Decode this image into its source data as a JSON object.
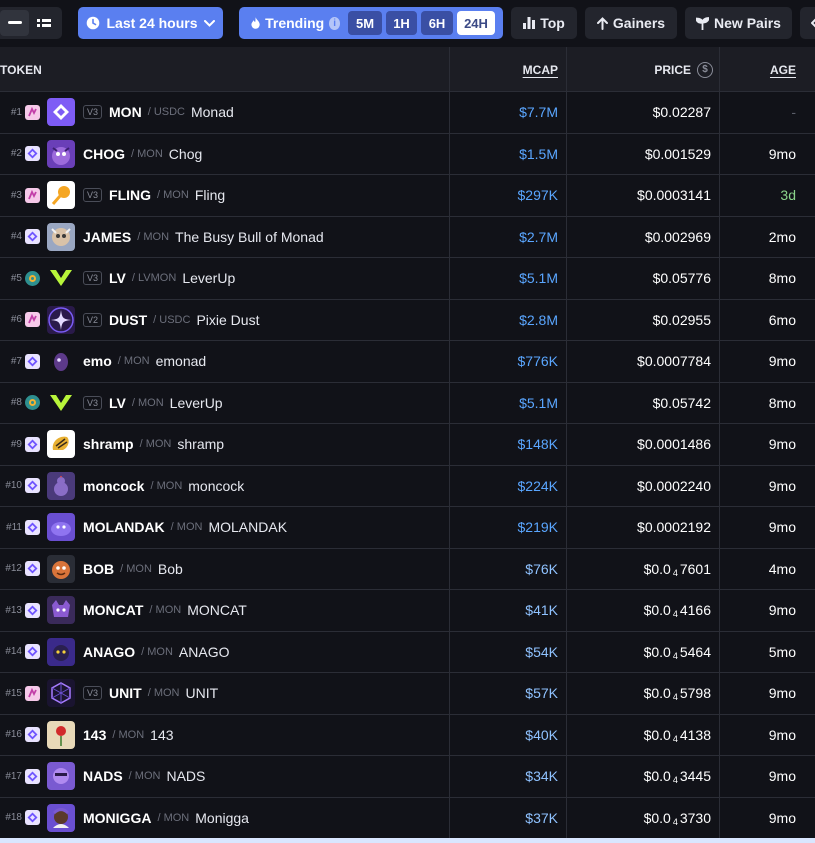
{
  "toolbar": {
    "timeframe_label": "Last 24 hours",
    "trending_label": "Trending",
    "trending_info": "i",
    "timeframes": [
      {
        "label": "5M",
        "active": false
      },
      {
        "label": "1H",
        "active": false
      },
      {
        "label": "6H",
        "active": false
      },
      {
        "label": "24H",
        "active": true
      }
    ],
    "top_label": "Top",
    "gainers_label": "Gainers",
    "new_pairs_label": "New Pairs",
    "accent_color": "#5a7ff0"
  },
  "table": {
    "headers": {
      "token": "TOKEN",
      "mcap": "MCAP",
      "price": "PRICE",
      "age": "AGE"
    },
    "rows": [
      {
        "rank": "#1",
        "chain": "pink",
        "logo": "monad-logo",
        "version": "V3",
        "symbol": "MON",
        "quote": "USDC",
        "name": "Monad",
        "mcap": "$7.7M",
        "price": "$0.02287",
        "age": "-"
      },
      {
        "rank": "#2",
        "chain": "purple",
        "logo": "chog-logo",
        "version": "",
        "symbol": "CHOG",
        "quote": "MON",
        "name": "Chog",
        "mcap": "$1.5M",
        "price": "$0.001529",
        "age": "9mo"
      },
      {
        "rank": "#3",
        "chain": "pink",
        "logo": "fling-logo",
        "version": "V3",
        "symbol": "FLING",
        "quote": "MON",
        "name": "Fling",
        "mcap": "$297K",
        "price": "$0.0003141",
        "age": "3d"
      },
      {
        "rank": "#4",
        "chain": "purple",
        "logo": "james-logo",
        "version": "",
        "symbol": "JAMES",
        "quote": "MON",
        "name": "The Busy Bull of Monad",
        "mcap": "$2.7M",
        "price": "$0.002969",
        "age": "2mo"
      },
      {
        "rank": "#5",
        "chain": "teal",
        "logo": "leverup-logo",
        "version": "V3",
        "symbol": "LV",
        "quote": "LVMON",
        "name": "LeverUp",
        "mcap": "$5.1M",
        "price": "$0.05776",
        "age": "8mo"
      },
      {
        "rank": "#6",
        "chain": "pink",
        "logo": "pixie-dust-logo",
        "version": "V2",
        "symbol": "DUST",
        "quote": "USDC",
        "name": "Pixie Dust",
        "mcap": "$2.8M",
        "price": "$0.02955",
        "age": "6mo"
      },
      {
        "rank": "#7",
        "chain": "purple",
        "logo": "emonad-logo",
        "version": "",
        "symbol": "emo",
        "quote": "MON",
        "name": "emonad",
        "mcap": "$776K",
        "price": "$0.0007784",
        "age": "9mo"
      },
      {
        "rank": "#8",
        "chain": "teal",
        "logo": "leverup-logo",
        "version": "V3",
        "symbol": "LV",
        "quote": "MON",
        "name": "LeverUp",
        "mcap": "$5.1M",
        "price": "$0.05742",
        "age": "8mo"
      },
      {
        "rank": "#9",
        "chain": "purple",
        "logo": "shramp-logo",
        "version": "",
        "symbol": "shramp",
        "quote": "MON",
        "name": "shramp",
        "mcap": "$148K",
        "price": "$0.0001486",
        "age": "9mo"
      },
      {
        "rank": "#10",
        "chain": "purple",
        "logo": "moncock-logo",
        "version": "",
        "symbol": "moncock",
        "quote": "MON",
        "name": "moncock",
        "mcap": "$224K",
        "price": "$0.0002240",
        "age": "9mo"
      },
      {
        "rank": "#11",
        "chain": "purple",
        "logo": "molandak-logo",
        "version": "",
        "symbol": "MOLANDAK",
        "quote": "MON",
        "name": "MOLANDAK",
        "mcap": "$219K",
        "price": "$0.0002192",
        "age": "9mo"
      },
      {
        "rank": "#12",
        "chain": "purple",
        "logo": "bob-logo",
        "version": "",
        "symbol": "BOB",
        "quote": "MON",
        "name": "Bob",
        "mcap": "$76K",
        "price_pre": "$0.0",
        "price_sub": "4",
        "price_post": "7601",
        "age": "4mo"
      },
      {
        "rank": "#13",
        "chain": "purple",
        "logo": "moncat-logo",
        "version": "",
        "symbol": "MONCAT",
        "quote": "MON",
        "name": "MONCAT",
        "mcap": "$41K",
        "price_pre": "$0.0",
        "price_sub": "4",
        "price_post": "4166",
        "age": "9mo"
      },
      {
        "rank": "#14",
        "chain": "purple",
        "logo": "anago-logo",
        "version": "",
        "symbol": "ANAGO",
        "quote": "MON",
        "name": "ANAGO",
        "mcap": "$54K",
        "price_pre": "$0.0",
        "price_sub": "4",
        "price_post": "5464",
        "age": "5mo"
      },
      {
        "rank": "#15",
        "chain": "pink",
        "logo": "unit-logo",
        "version": "V3",
        "symbol": "UNIT",
        "quote": "MON",
        "name": "UNIT",
        "mcap": "$57K",
        "price_pre": "$0.0",
        "price_sub": "4",
        "price_post": "5798",
        "age": "9mo"
      },
      {
        "rank": "#16",
        "chain": "purple",
        "logo": "rose-logo",
        "version": "",
        "symbol": "143",
        "quote": "MON",
        "name": "143",
        "mcap": "$40K",
        "price_pre": "$0.0",
        "price_sub": "4",
        "price_post": "4138",
        "age": "9mo"
      },
      {
        "rank": "#17",
        "chain": "purple",
        "logo": "nads-logo",
        "version": "",
        "symbol": "NADS",
        "quote": "MON",
        "name": "NADS",
        "mcap": "$34K",
        "price_pre": "$0.0",
        "price_sub": "4",
        "price_post": "3445",
        "age": "9mo"
      },
      {
        "rank": "#18",
        "chain": "purple",
        "logo": "monigga-logo",
        "version": "",
        "symbol": "MONIGGA",
        "quote": "MON",
        "name": "Monigga",
        "mcap": "$37K",
        "price_pre": "$0.0",
        "price_sub": "4",
        "price_post": "3730",
        "age": "9mo"
      }
    ]
  }
}
